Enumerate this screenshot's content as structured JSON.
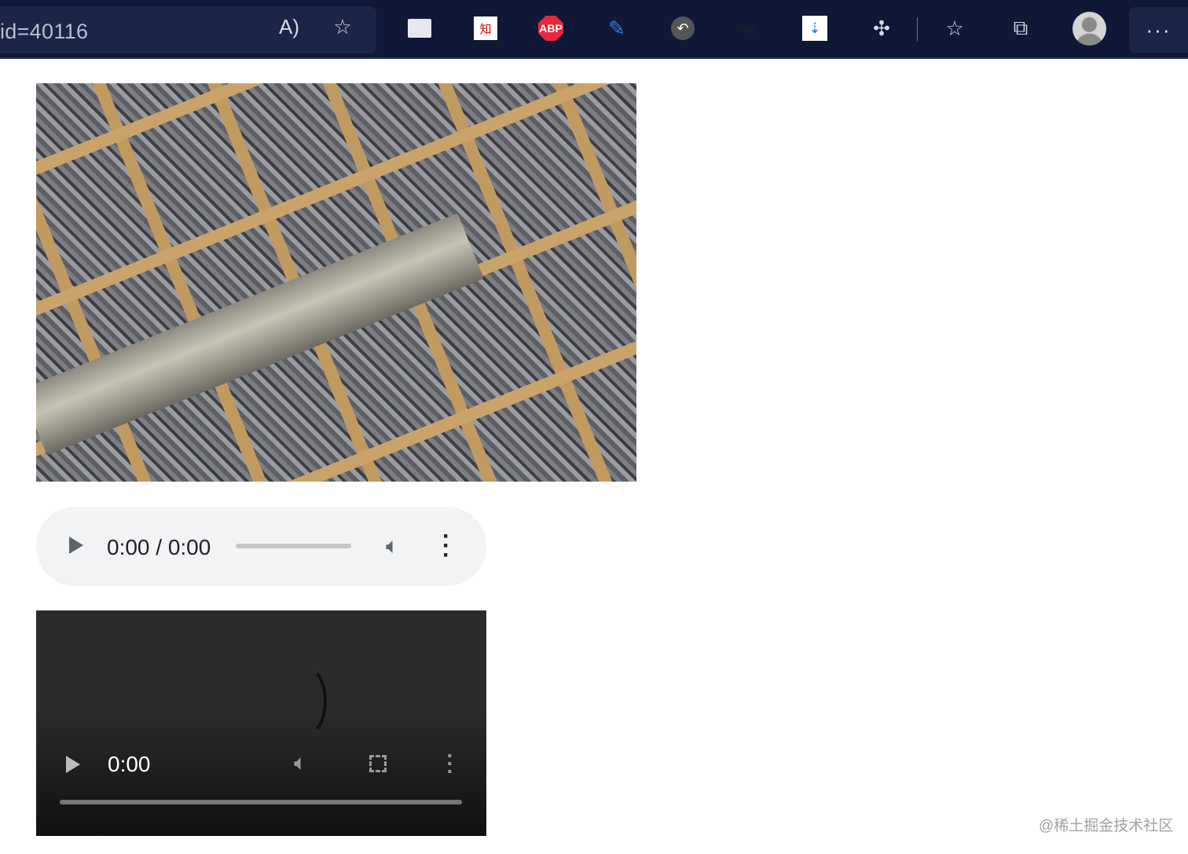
{
  "browser": {
    "address_text": "id=40116",
    "icons": [
      "read-aloud-icon",
      "add-favorite-icon",
      "extension-save-icon",
      "extension-zhihu-icon",
      "adblock-plus-icon",
      "extension-pen-icon",
      "extension-back-icon",
      "extension-translate-icon",
      "extension-download-icon",
      "extensions-icon",
      "favorites-icon",
      "collections-icon",
      "profile-avatar-icon",
      "more-icon"
    ],
    "extension_labels": {
      "zhihu": "知",
      "abp": "ABP",
      "translate": "en"
    },
    "more_label": "···"
  },
  "audio": {
    "time": "0:00 / 0:00",
    "progress": 0
  },
  "video": {
    "time": "0:00",
    "progress": 0
  },
  "watermark": "@稀土掘金技术社区"
}
